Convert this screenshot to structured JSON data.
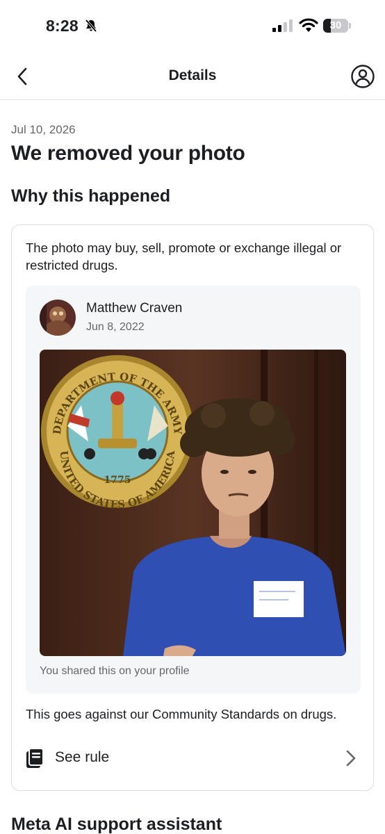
{
  "status_bar": {
    "time": "8:28",
    "battery_level": "30",
    "battery_fraction": 0.3
  },
  "nav": {
    "title": "Details",
    "back_icon": "chevron-left-icon",
    "profile_icon": "person-circle-icon"
  },
  "notice": {
    "date": "Jul 10, 2026",
    "title": "We removed your photo",
    "section_heading": "Why this happened",
    "reason": "The photo may buy, sell, promote or exchange illegal or restricted drugs.",
    "post": {
      "author": "Matthew Craven",
      "date": "Jun 8, 2022",
      "shared_note": "You shared this on your profile",
      "seal_text_top": "DEPARTMENT OF THE ARMY",
      "seal_text_bottom": "UNITED STATES OF AMERICA",
      "seal_year": "1775"
    },
    "standards": "This goes against our Community Standards on drugs.",
    "see_rule_label": "See rule",
    "rule_icon": "book-icon"
  },
  "next_section_heading": "Meta AI support assistant",
  "colors": {
    "text_primary": "#1c1e21",
    "text_secondary": "#65676b",
    "border": "#dadde1",
    "post_background": "#f5f6f7"
  }
}
